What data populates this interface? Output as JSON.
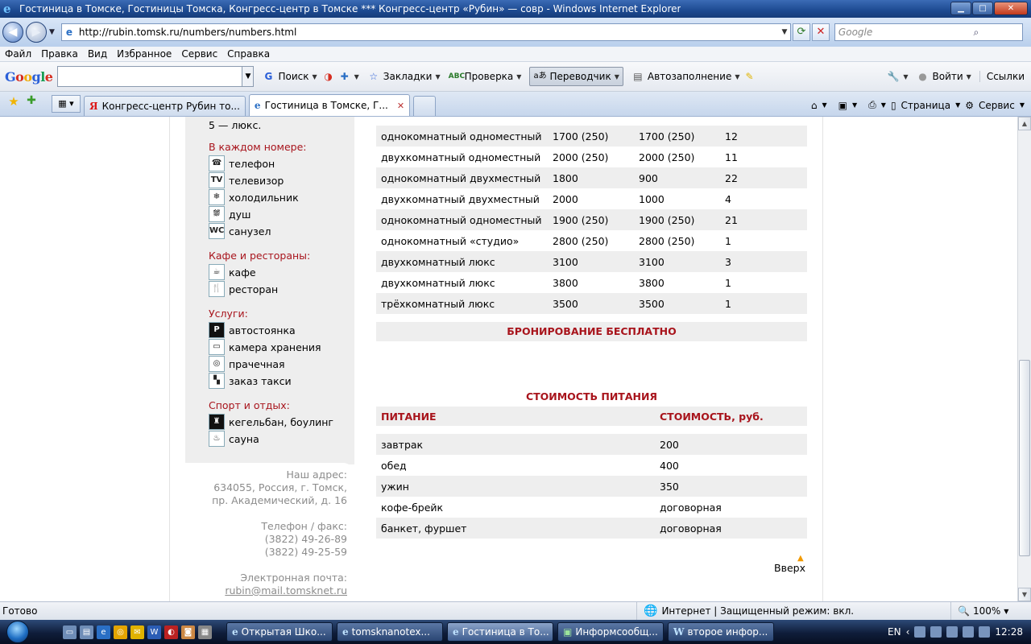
{
  "window": {
    "title": "Гостиница в Томске, Гостиницы Томска, Конгресс-центр в Томске *** Конгресс-центр «Рубин» — совр - Windows Internet Explorer"
  },
  "address_bar": {
    "url": "http://rubin.tomsk.ru/numbers/numbers.html",
    "search_placeholder": "Google"
  },
  "menu": [
    "Файл",
    "Правка",
    "Вид",
    "Избранное",
    "Сервис",
    "Справка"
  ],
  "google_toolbar": {
    "logo": [
      "G",
      "o",
      "o",
      "g",
      "l",
      "e"
    ],
    "search_label": "Поиск",
    "bookmarks_label": "Закладки",
    "check_label": "Проверка",
    "translator_label": "Переводчик",
    "autofill_label": "Автозаполнение",
    "signin_label": "Войти",
    "links_label": "Ссылки"
  },
  "tabs": [
    {
      "label": "Конгресс-центр Рубин то...",
      "icon": "yandex-icon",
      "active": false
    },
    {
      "label": "Гостиница в Томске, Г...",
      "icon": "ie-icon",
      "active": true
    }
  ],
  "command_bar": {
    "page_label": "Страница",
    "service_label": "Сервис"
  },
  "sidebar": {
    "top_line": "5 — люкс.",
    "sections": [
      {
        "heading": "В каждом номере:",
        "items": [
          {
            "icon": "☎",
            "label": "телефон"
          },
          {
            "icon": "TV",
            "label": "телевизор"
          },
          {
            "icon": "❄",
            "label": "холодильник"
          },
          {
            "icon": "⛆",
            "label": "душ"
          },
          {
            "icon": "WC",
            "label": "санузел"
          }
        ]
      },
      {
        "heading": "Кафе и рестораны:",
        "items": [
          {
            "icon": "☕",
            "label": "кафе"
          },
          {
            "icon": "🍴",
            "label": "ресторан"
          }
        ]
      },
      {
        "heading": "Услуги:",
        "items": [
          {
            "icon": "P",
            "label": "автостоянка"
          },
          {
            "icon": "▭",
            "label": "камера хранения"
          },
          {
            "icon": "◎",
            "label": "прачечная"
          },
          {
            "icon": "▚",
            "label": "заказ такси"
          }
        ]
      },
      {
        "heading": "Спорт и отдых:",
        "items": [
          {
            "icon": "♜",
            "label": "кегельбан, боулинг"
          },
          {
            "icon": "♨",
            "label": "сауна"
          }
        ]
      }
    ],
    "address_heading": "Наш адрес:",
    "address_lines": [
      "634055, Россия, г. Томск,",
      "пр. Академический, д. 16"
    ],
    "phone_heading": "Телефон / факс:",
    "phones": [
      "(3822) 49-26-89",
      "(3822) 49-25-59"
    ],
    "email_heading": "Электронная почта:",
    "email": "rubin@mail.tomsknet.ru"
  },
  "rooms_table": {
    "rows": [
      [
        "однокомнатный одноместный",
        "1700 (250)",
        "1700 (250)",
        "12"
      ],
      [
        "двухкомнатный одноместный",
        "2000 (250)",
        "2000 (250)",
        "11"
      ],
      [
        "однокомнатный двухместный",
        "1800",
        "900",
        "22"
      ],
      [
        "двухкомнатный двухместный",
        "2000",
        "1000",
        "4"
      ],
      [
        "однокомнатный одноместный",
        "1900 (250)",
        "1900 (250)",
        "21"
      ],
      [
        "однокомнатный «студио»",
        "2800 (250)",
        "2800 (250)",
        "1"
      ],
      [
        "двухкомнатный люкс",
        "3100",
        "3100",
        "3"
      ],
      [
        "двухкомнатный люкс",
        "3800",
        "3800",
        "1"
      ],
      [
        "трёхкомнатный люкс",
        "3500",
        "3500",
        "1"
      ]
    ],
    "booking_note": "БРОНИРОВАНИЕ БЕСПЛАТНО"
  },
  "food_table": {
    "title": "СТОИМОСТЬ ПИТАНИЯ",
    "headers": [
      "ПИТАНИЕ",
      "СТОИМОСТЬ, руб."
    ],
    "rows": [
      [
        "завтрак",
        "200"
      ],
      [
        "обед",
        "400"
      ],
      [
        "ужин",
        "350"
      ],
      [
        "кофе-брейк",
        "договорная"
      ],
      [
        "банкет, фуршет",
        "договорная"
      ]
    ]
  },
  "back_to_top": "Вверх",
  "status_bar": {
    "ready": "Готово",
    "zone": "Интернет | Защищенный режим: вкл.",
    "zoom": "100%"
  },
  "taskbar": {
    "tasks": [
      {
        "label": "Открытая Шко...",
        "active": false
      },
      {
        "label": "tomsknanotex...",
        "active": false
      },
      {
        "label": "Гостиница в То...",
        "active": true
      },
      {
        "label": "Информсообщ...",
        "active": false
      },
      {
        "label": "второе инфор...",
        "active": false
      }
    ],
    "lang": "EN",
    "clock": "12:28"
  }
}
